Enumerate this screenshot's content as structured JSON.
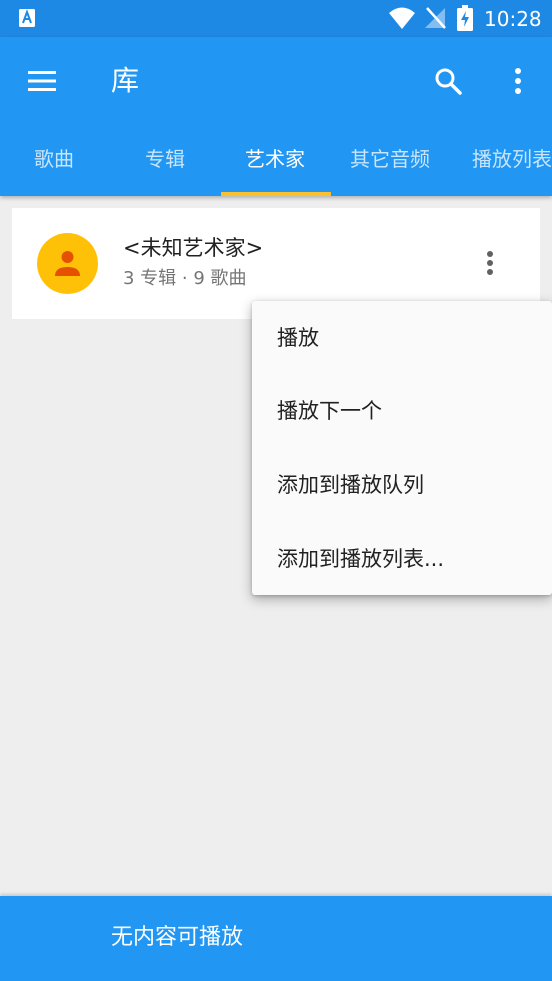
{
  "colors": {
    "status_bar": "#1e88e5",
    "app_bar": "#2196f3",
    "tab_indicator": "#fbc02d",
    "avatar": "#ffc107",
    "avatar_figure": "#e65100",
    "background": "#eeeeee"
  },
  "status_bar": {
    "time": "10:28",
    "icons": [
      "app-notification-icon",
      "wifi-icon",
      "no-signal-icon",
      "battery-charging-icon"
    ]
  },
  "app_bar": {
    "title": "库",
    "icons": [
      "menu-icon",
      "search-icon",
      "more-vert-icon"
    ]
  },
  "tabs": [
    {
      "label": "歌曲",
      "active": false
    },
    {
      "label": "专辑",
      "active": false
    },
    {
      "label": "艺术家",
      "active": true
    },
    {
      "label": "其它音频",
      "active": false
    },
    {
      "label": "播放列表",
      "active": false
    }
  ],
  "artist": {
    "name": "<未知艺术家>",
    "meta": "3 专辑 · 9 歌曲",
    "avatar_icon": "person-icon",
    "more_icon": "more-vert-icon"
  },
  "popup_menu": {
    "items": [
      {
        "label": "播放"
      },
      {
        "label": "播放下一个"
      },
      {
        "label": "添加到播放队列"
      },
      {
        "label": "添加到播放列表..."
      }
    ]
  },
  "bottom_bar": {
    "text": "无内容可播放"
  }
}
